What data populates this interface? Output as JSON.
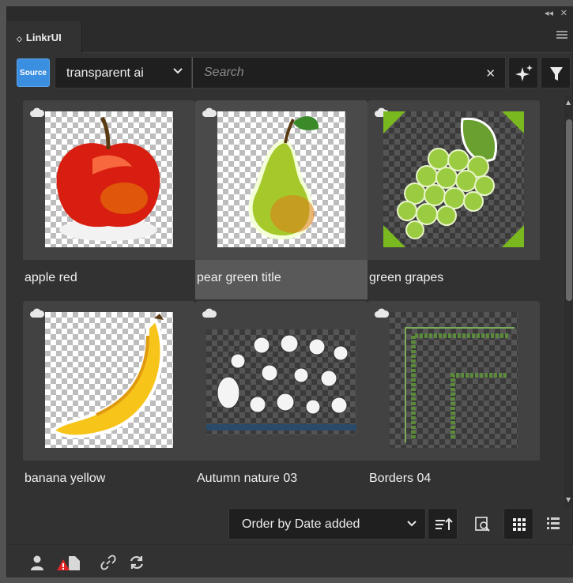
{
  "window": {
    "collapse_icon": "double-chevron-left-icon",
    "close_icon": "close-icon"
  },
  "tab": {
    "title": "LinkrUI",
    "menu_icon": "hamburger-menu-icon"
  },
  "toolbar": {
    "source_label": "Source",
    "library_selected": "transparent ai",
    "search_placeholder": "Search",
    "search_value": "",
    "clear_icon": "close-icon",
    "ai_icon": "sparkle-icon",
    "filter_icon": "filter-funnel-icon",
    "accent_color": "#3b8fe0"
  },
  "assets": [
    {
      "label": "apple red",
      "cloud": true,
      "selected": false
    },
    {
      "label": "pear green title",
      "cloud": true,
      "selected": true
    },
    {
      "label": "green grapes",
      "cloud": true,
      "selected": false
    },
    {
      "label": "banana yellow",
      "cloud": true,
      "selected": false
    },
    {
      "label": "Autumn nature 03",
      "cloud": true,
      "selected": false
    },
    {
      "label": "Borders 04",
      "cloud": true,
      "selected": false
    }
  ],
  "sort": {
    "order_label": "Order by Date added",
    "sort_direction_icon": "sort-ascending-icon",
    "preview_icon": "zoom-preview-icon",
    "grid_view_icon": "grid-view-icon",
    "list_view_icon": "list-view-icon",
    "active_view": "grid"
  },
  "footer": {
    "icons": [
      "user-icon",
      "document-warning-icon",
      "link-icon",
      "refresh-icon"
    ],
    "warning_color": "#e02424"
  }
}
